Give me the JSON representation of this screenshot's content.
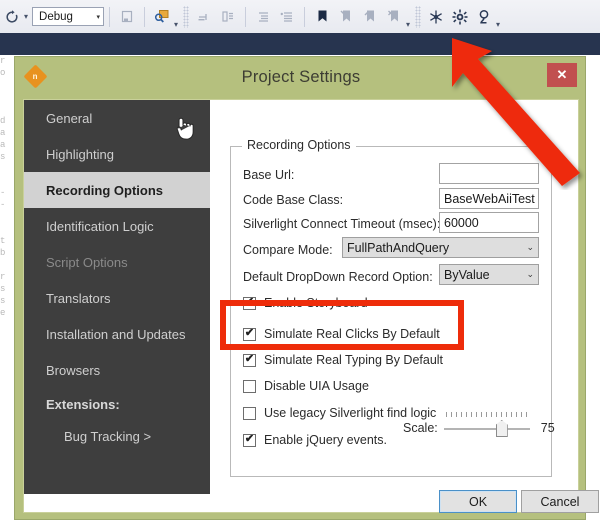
{
  "toolbar": {
    "refresh_icon": "refresh-icon",
    "refresh_caret": "▾",
    "config_value": "Debug",
    "config_caret": "▾",
    "items": [
      {
        "name": "new-window-icon",
        "dim": true
      },
      {
        "name": "find-icon",
        "dim": false
      },
      {
        "name": "step-into-icon",
        "dim": true
      },
      {
        "name": "step-over-icon",
        "dim": true
      },
      {
        "name": "indent-icon",
        "dim": true
      },
      {
        "name": "comment-icon",
        "dim": true
      },
      {
        "name": "bookmark-icon",
        "dim": false
      },
      {
        "name": "previous-bookmark-icon",
        "dim": true
      },
      {
        "name": "next-bookmark-icon",
        "dim": true
      },
      {
        "name": "clear-bookmarks-icon",
        "dim": true
      },
      {
        "name": "atom-icon",
        "dim": false
      },
      {
        "name": "gear-icon",
        "dim": false
      },
      {
        "name": "magnifier-icon",
        "dim": false
      }
    ],
    "overflow_caret": "▾"
  },
  "ghost_text": "r\no\n\n \n \nd\na\na\ns\n \n \n-\n-\n \n \nt\nb\n \nr\ns\ns\ne\n",
  "dialog": {
    "title": "Project Settings",
    "app_icon": "app-diamond-icon",
    "app_icon_glyph": "n",
    "close_label": "✕",
    "sidebar": [
      {
        "label": "General",
        "state": "normal"
      },
      {
        "label": "Highlighting",
        "state": "normal"
      },
      {
        "label": "Recording Options",
        "state": "selected"
      },
      {
        "label": "Identification Logic",
        "state": "normal"
      },
      {
        "label": "Script Options",
        "state": "disabled"
      },
      {
        "label": "Translators",
        "state": "normal"
      },
      {
        "label": "Installation and Updates",
        "state": "normal"
      },
      {
        "label": "Browsers",
        "state": "normal"
      },
      {
        "label": "Extensions:",
        "state": "header"
      },
      {
        "label": "Bug Tracking >",
        "state": "sub"
      }
    ],
    "group": {
      "legend": "Recording Options",
      "fields": [
        {
          "label": "Base Url:",
          "value": "",
          "kind": "text"
        },
        {
          "label": "Code Base Class:",
          "value": "BaseWebAiiTest",
          "kind": "text"
        },
        {
          "label": "Silverlight Connect Timeout (msec):",
          "value": "60000",
          "kind": "text"
        },
        {
          "label": "Compare Mode:",
          "value": "FullPathAndQuery",
          "kind": "select"
        },
        {
          "label": "Default DropDown Record Option:",
          "value": "ByValue",
          "kind": "select"
        }
      ],
      "select_caret": "⌄",
      "checkboxes": [
        {
          "label": "Enable Storyboard",
          "checked": true
        },
        {
          "label": "Simulate Real Clicks By Default",
          "checked": true
        },
        {
          "label": "Simulate Real Typing By Default",
          "checked": true
        },
        {
          "label": "Disable UIA Usage",
          "checked": false
        },
        {
          "label": "Use legacy Silverlight find logic",
          "checked": false
        },
        {
          "label": "Enable jQuery events.",
          "checked": true
        }
      ],
      "check_glyph": "✔",
      "scale": {
        "label": "Scale:",
        "value": "75"
      }
    },
    "buttons": {
      "ok": "OK",
      "cancel": "Cancel"
    }
  },
  "annotations": {
    "highlight_box": "red-highlight-rectangle",
    "arrow": "red-pointer-arrow",
    "color": "#ee2c0a"
  },
  "colors": {
    "dialog_frame": "#b5c07e",
    "sidebar": "#3e3e3e",
    "selected_nav": "#d2d2d2",
    "close_button": "#c14f4f",
    "vs_band": "#27344f",
    "app_icon": "#e8921f"
  }
}
